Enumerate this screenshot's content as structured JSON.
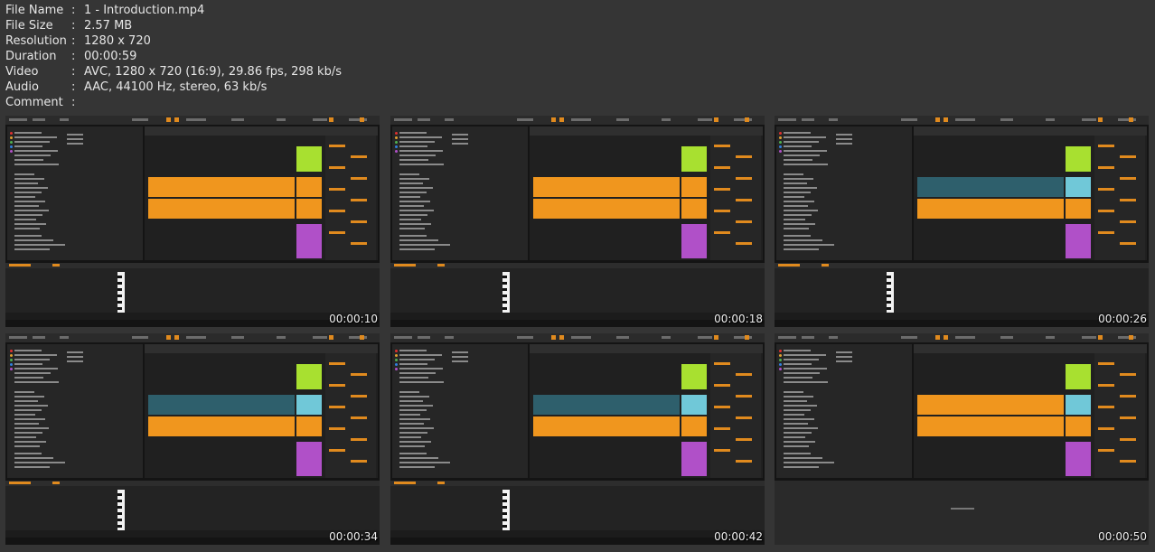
{
  "file_info": {
    "separator": ":",
    "rows": [
      {
        "key": "File Name",
        "value": "1 - Introduction.mp4"
      },
      {
        "key": "File Size",
        "value": "2.57 MB"
      },
      {
        "key": "Resolution",
        "value": "1280 x 720"
      },
      {
        "key": "Duration",
        "value": "00:00:59"
      },
      {
        "key": "Video",
        "value": "AVC, 1280 x 720 (16:9), 29.86 fps, 298 kb/s"
      },
      {
        "key": "Audio",
        "value": "AAC, 44100 Hz, stereo, 63 kb/s"
      },
      {
        "key": "Comment",
        "value": ""
      }
    ]
  },
  "thumbnails": [
    {
      "timestamp": "00:00:10",
      "variant": "orange"
    },
    {
      "timestamp": "00:00:18",
      "variant": "orange"
    },
    {
      "timestamp": "00:00:26",
      "variant": "teal"
    },
    {
      "timestamp": "00:00:34",
      "variant": "teal"
    },
    {
      "timestamp": "00:00:42",
      "variant": "teal"
    },
    {
      "timestamp": "00:00:50",
      "variant": "empty"
    }
  ],
  "colors": {
    "background": "#353535",
    "text": "#e6e6e6",
    "clip_orange": "#f0961e",
    "clip_teal": "#2e5f6c",
    "insert_lime": "#a8e030",
    "insert_cyan": "#70c8d8",
    "insert_orange": "#f0961e",
    "insert_purple": "#b050c8"
  }
}
